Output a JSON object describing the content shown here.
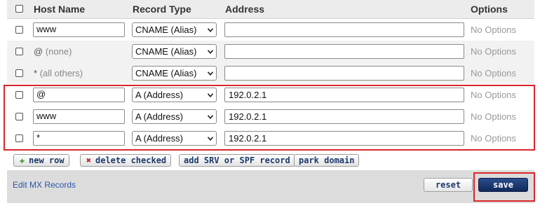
{
  "header": {
    "host_name": "Host Name",
    "record_type": "Record Type",
    "address": "Address",
    "options": "Options"
  },
  "rows": [
    {
      "host_value": "www",
      "host_is_input": true,
      "record_type": "CNAME (Alias)",
      "address": "",
      "options": "No Options"
    },
    {
      "host_value": "@",
      "host_sub": "(none)",
      "host_is_input": false,
      "record_type": "CNAME (Alias)",
      "address": "",
      "options": "No Options"
    },
    {
      "host_value": "*",
      "host_sub": "(all others)",
      "host_is_input": false,
      "record_type": "CNAME (Alias)",
      "address": "",
      "options": "No Options"
    },
    {
      "host_value": "@",
      "host_is_input": true,
      "record_type": "A (Address)",
      "address": "192.0.2.1",
      "options": "No Options"
    },
    {
      "host_value": "www",
      "host_is_input": true,
      "record_type": "A (Address)",
      "address": "192.0.2.1",
      "options": "No Options"
    },
    {
      "host_value": "*",
      "host_is_input": true,
      "record_type": "A (Address)",
      "address": "192.0.2.1",
      "options": "No Options"
    }
  ],
  "toolbar": {
    "new_row": "new row",
    "delete_checked": "delete checked",
    "add_srv_spf": "add SRV or SPF record",
    "park_domain": "park domain"
  },
  "footer": {
    "mx_link": "Edit MX Records",
    "reset": "reset",
    "save": "save"
  },
  "colors": {
    "highlight": "#d9262c",
    "save_bg": "#102a5c",
    "link": "#2855a8"
  },
  "icons": {
    "new_row": "plus-icon",
    "delete_checked": "x-icon",
    "select_arrow": "chevron-down-icon"
  }
}
